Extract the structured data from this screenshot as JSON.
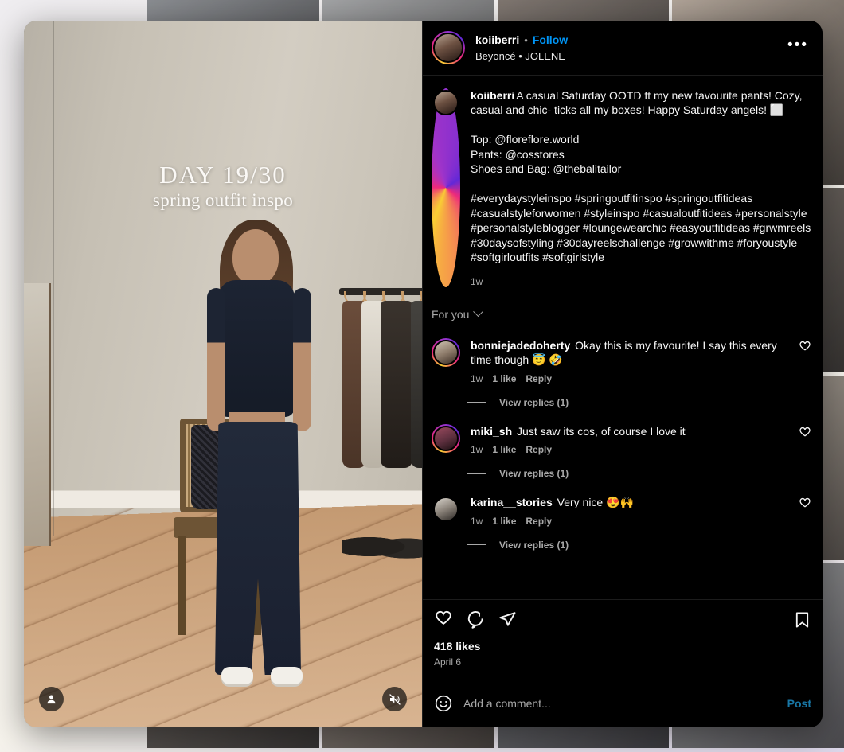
{
  "post": {
    "header": {
      "username": "koiiberri",
      "separator": "•",
      "follow_label": "Follow",
      "audio": "Beyoncé • JOLENE",
      "more_options_label": "•••"
    },
    "caption": {
      "username": "koiiberri",
      "text": "A casual Saturday OOTD ft my new favourite pants! Cozy, casual and chic- ticks all my boxes! Happy Saturday angels! ⬜\n\nTop: @floreflore.world\nPants: @cosstores\nShoes and Bag: @thebalitailor\n\n#everydaystyleinspo #springoutfitinspo #springoutfitideas #casualstyleforwomen #styleinspo #casualoutfitideas #personalstyle #personalstyleblogger #loungewearchic #easyoutfitideas #grwmreels #30daysofstyling #30dayreelschallenge #growwithme #foryoustyle #softgirloutfits #softgirlstyle",
      "time": "1w"
    },
    "filter": {
      "label": "For you"
    },
    "comments": [
      {
        "username": "bonniejadedoherty",
        "text": "Okay this is my favourite! I say this every time though 😇 🤣",
        "time": "1w",
        "likes": "1 like",
        "reply_label": "Reply",
        "view_replies": "View replies (1)",
        "has_story_ring": true
      },
      {
        "username": "miki_sh",
        "text": "Just saw its cos, of course I love it",
        "time": "1w",
        "likes": "1 like",
        "reply_label": "Reply",
        "view_replies": "View replies (1)",
        "has_story_ring": true
      },
      {
        "username": "karina__stories",
        "text": "Very nice 😍🙌",
        "time": "1w",
        "likes": "1 like",
        "reply_label": "Reply",
        "view_replies": "View replies (1)",
        "has_story_ring": false
      }
    ],
    "actions": {
      "like_icon": "heart-icon",
      "comment_icon": "comment-icon",
      "share_icon": "share-icon",
      "save_icon": "bookmark-icon",
      "likes_count": "418 likes",
      "date": "April 6"
    },
    "composer": {
      "emoji_icon": "emoji-icon",
      "placeholder": "Add a comment...",
      "value": "",
      "post_label": "Post"
    }
  },
  "media": {
    "overlay_day": "DAY 19/30",
    "overlay_subtitle": "spring outfit inspo",
    "tag_people_icon": "person-tag-icon",
    "mute_icon": "speaker-muted-icon"
  },
  "colors": {
    "accent_link": "#0095f6",
    "post_disabled": "#1877a6",
    "muted_text": "#a8a8a8",
    "panel_bg": "#000000"
  }
}
